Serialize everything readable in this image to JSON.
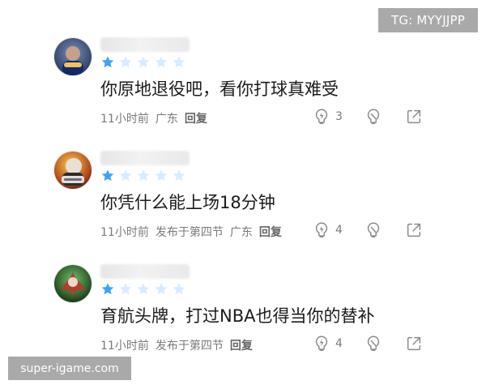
{
  "watermark": {
    "tg_label": "TG: MYYJJPP",
    "site": "super-igame.com"
  },
  "comments": [
    {
      "rating": 1,
      "text": "你原地退役吧，看你打球真难受",
      "time": "11小时前",
      "extra": "",
      "location": "广东",
      "reply_label": "回复",
      "likes": "3"
    },
    {
      "rating": 1,
      "text": "你凭什么能上场18分钟",
      "time": "11小时前",
      "extra": "发布于第四节",
      "location": "广东",
      "reply_label": "回复",
      "likes": "4"
    },
    {
      "rating": 1,
      "text": "育航头牌，打过NBA也得当你的替补",
      "time": "11小时前",
      "extra": "发布于第四节",
      "location": "",
      "reply_label": "回复",
      "likes": "4"
    }
  ],
  "colors": {
    "star_active": "#3aa3ff",
    "star_inactive": "#d7ecff"
  }
}
